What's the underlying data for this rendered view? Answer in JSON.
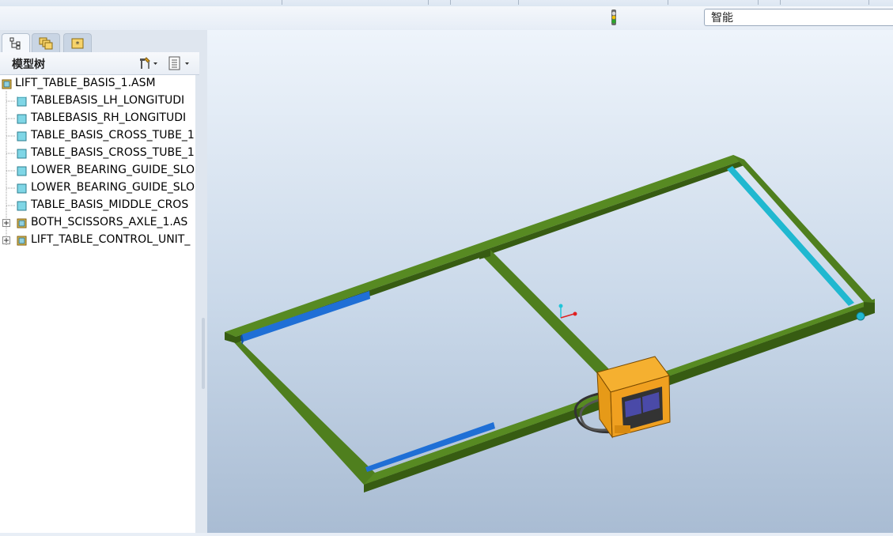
{
  "toolbar": {
    "search_value": "智能"
  },
  "model_tree": {
    "title": "模型树",
    "root": "LIFT_TABLE_BASIS_1.ASM",
    "items": [
      {
        "label": "TABLEBASIS_LH_LONGITUDI",
        "type": "part"
      },
      {
        "label": "TABLEBASIS_RH_LONGITUDI",
        "type": "part"
      },
      {
        "label": "TABLE_BASIS_CROSS_TUBE_1",
        "type": "part"
      },
      {
        "label": "TABLE_BASIS_CROSS_TUBE_1",
        "type": "part"
      },
      {
        "label": "LOWER_BEARING_GUIDE_SLO",
        "type": "part"
      },
      {
        "label": "LOWER_BEARING_GUIDE_SLO",
        "type": "part"
      },
      {
        "label": "TABLE_BASIS_MIDDLE_CROS",
        "type": "part"
      },
      {
        "label": "BOTH_SCISSORS_AXLE_1.AS",
        "type": "assembly"
      },
      {
        "label": "LIFT_TABLE_CONTROL_UNIT_",
        "type": "assembly"
      }
    ]
  },
  "colors": {
    "frame": "#4f7f1e",
    "frame_dark": "#375c12",
    "rail_blue": "#1f6fd6",
    "rail_cyan": "#20b8d0",
    "control_box": "#f0a020"
  },
  "icons": [
    "status-light-icon",
    "model-tree-tab-icon",
    "layer-tab-icon",
    "favorites-tab-icon",
    "settings-icon",
    "show-icon",
    "assembly-icon",
    "part-icon",
    "expand-icon"
  ]
}
